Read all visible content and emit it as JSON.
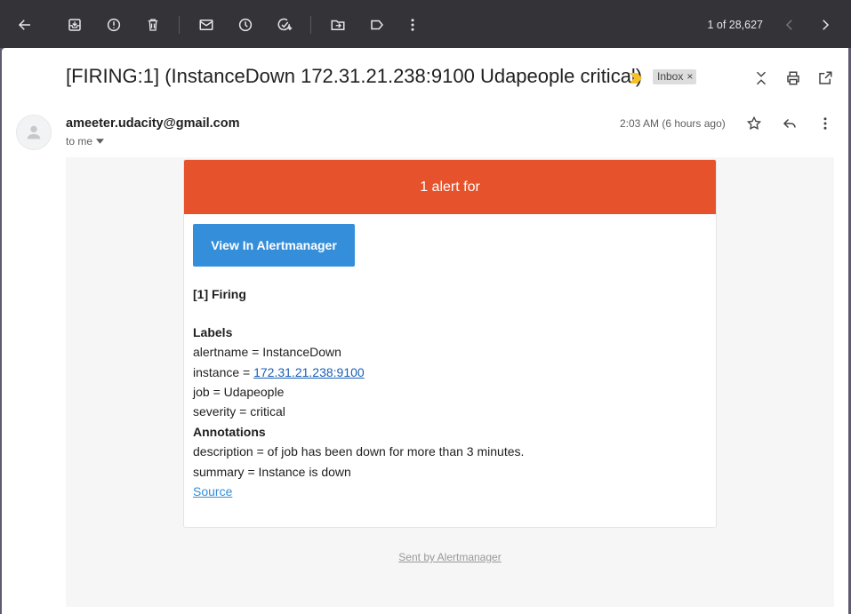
{
  "toolbar": {
    "pager": "1 of 28,627",
    "icons": [
      "back-icon",
      "archive-icon",
      "report-spam-icon",
      "delete-icon",
      "mark-unread-icon",
      "snooze-icon",
      "add-task-icon",
      "move-to-icon",
      "label-icon",
      "more-vert-icon",
      "prev-icon",
      "next-icon"
    ]
  },
  "email": {
    "subject": "[FIRING:1] (InstanceDown 172.31.21.238:9100 Udapeople critical)",
    "label_chip": "Inbox",
    "label_chip_close": "×",
    "sender": "ameeter.udacity@gmail.com",
    "to": "to me",
    "time": "2:03 AM (6 hours ago)"
  },
  "alert": {
    "header": "1 alert for",
    "button": "View In Alertmanager",
    "firing_title": "[1] Firing",
    "labels_heading": "Labels",
    "alertname": "alertname = InstanceDown",
    "instance_prefix": "instance = ",
    "instance_link": "172.31.21.238:9100",
    "job": "job = Udapeople",
    "severity": "severity = critical",
    "annotations_heading": "Annotations",
    "description": "description = of job has been down for more than 3 minutes.",
    "summary": "summary = Instance is down",
    "source_link": "Source",
    "footer": "Sent by Alertmanager"
  },
  "colors": {
    "toolbar_bg": "#343338",
    "alert_header": "#e6522c",
    "button_blue": "#348eda",
    "importance": "#f6c026"
  }
}
